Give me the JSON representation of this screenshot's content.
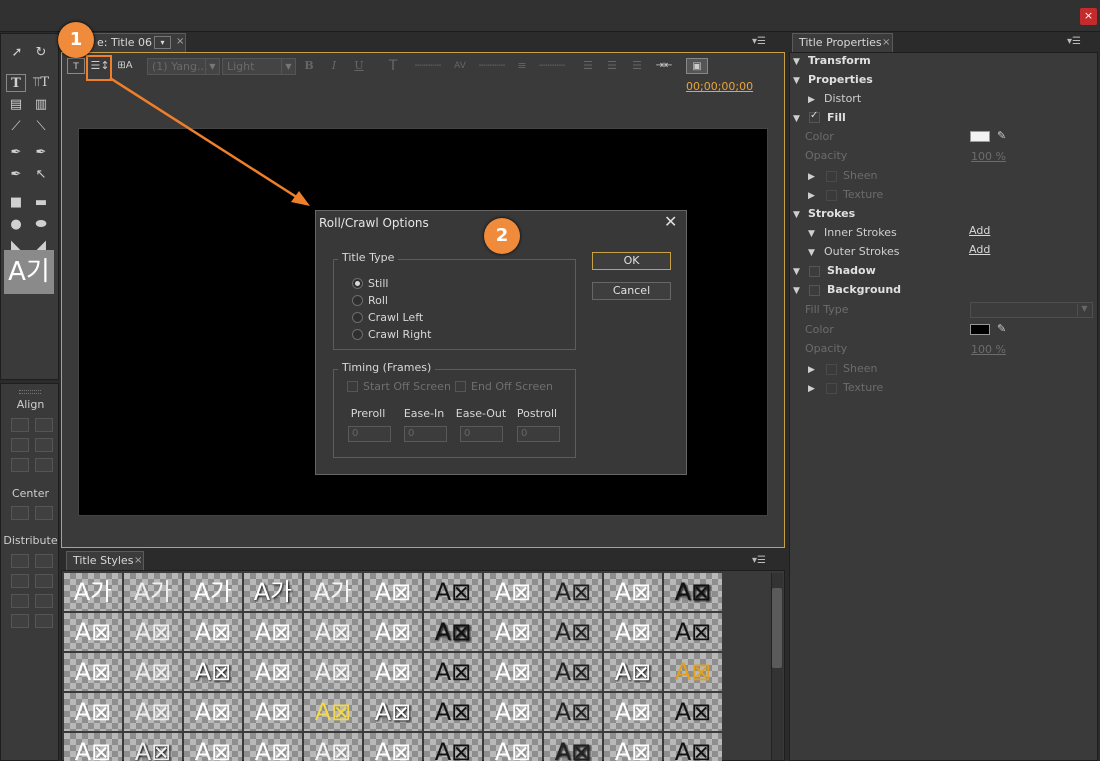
{
  "app": {
    "close_label": "×"
  },
  "title_panel": {
    "tab_label": "e: Title 06",
    "tab_dropdown": "▾",
    "tab_close": "×",
    "panel_menu": "▾☰",
    "toolbar": {
      "font_family": "(1) Yang...",
      "font_style": "Light",
      "bold": "B",
      "italic": "I",
      "underline": "U",
      "timecode": "00;00;00;00"
    }
  },
  "dialog": {
    "title": "Roll/Crawl Options",
    "close": "✕",
    "title_type_label": "Title Type",
    "options": [
      "Still",
      "Roll",
      "Crawl Left",
      "Crawl Right"
    ],
    "selected_option": "Still",
    "timing_label": "Timing (Frames)",
    "start_off_screen": "Start Off Screen",
    "end_off_screen": "End Off Screen",
    "fields": [
      {
        "label": "Preroll",
        "value": "0"
      },
      {
        "label": "Ease-In",
        "value": "0"
      },
      {
        "label": "Ease-Out",
        "value": "0"
      },
      {
        "label": "Postroll",
        "value": "0"
      }
    ],
    "ok": "OK",
    "cancel": "Cancel"
  },
  "badges": {
    "one": "1",
    "two": "2"
  },
  "tools_panel": {
    "preview": "A기"
  },
  "actions_panel": {
    "align": "Align",
    "center": "Center",
    "distribute": "Distribute"
  },
  "title_styles": {
    "tab_label": "Title Styles",
    "tab_close": "×",
    "panel_menu": "▾☰",
    "swatches": [
      "A가",
      "A가",
      "A가",
      "A가",
      "A가",
      "A⊠",
      "A⊠",
      "A⊠",
      "A⊠",
      "A⊠",
      "A⊠",
      "A⊠",
      "A⊠",
      "A⊠",
      "A⊠",
      "A⊠",
      "A⊠",
      "A⊠",
      "A⊠",
      "A⊠",
      "A⊠",
      "A⊠",
      "A⊠",
      "A⊠",
      "A⊠",
      "A⊠",
      "A⊠",
      "A⊠",
      "A⊠",
      "A⊠",
      "A⊠",
      "A⊠",
      "A⊠",
      "A⊠",
      "A⊠",
      "A⊠",
      "A⊠",
      "A⊠",
      "A⊠",
      "A⊠",
      "A⊠",
      "A⊠",
      "A⊠",
      "A⊠",
      "A⊠",
      "A⊠",
      "A⊠",
      "A⊠",
      "A⊠",
      "A⊠",
      "A⊠",
      "A⊠",
      "A⊠",
      "A⊠",
      "A⊠"
    ]
  },
  "title_properties": {
    "tab_label": "Title Properties",
    "tab_close": "×",
    "panel_menu": "▾☰",
    "transform": "Transform",
    "properties": "Properties",
    "distort": "Distort",
    "fill": "Fill",
    "color": "Color",
    "opacity": "Opacity",
    "opacity_value": "100 %",
    "sheen": "Sheen",
    "texture": "Texture",
    "strokes": "Strokes",
    "inner_strokes": "Inner Strokes",
    "outer_strokes": "Outer Strokes",
    "add": "Add",
    "shadow": "Shadow",
    "background": "Background",
    "fill_type": "Fill Type",
    "bg_color": "Color",
    "bg_opacity": "Opacity",
    "bg_opacity_value": "100 %",
    "bg_sheen": "Sheen",
    "bg_texture": "Texture",
    "colors": {
      "fill_color": "#f2f2f2",
      "background_color": "#000000"
    }
  }
}
